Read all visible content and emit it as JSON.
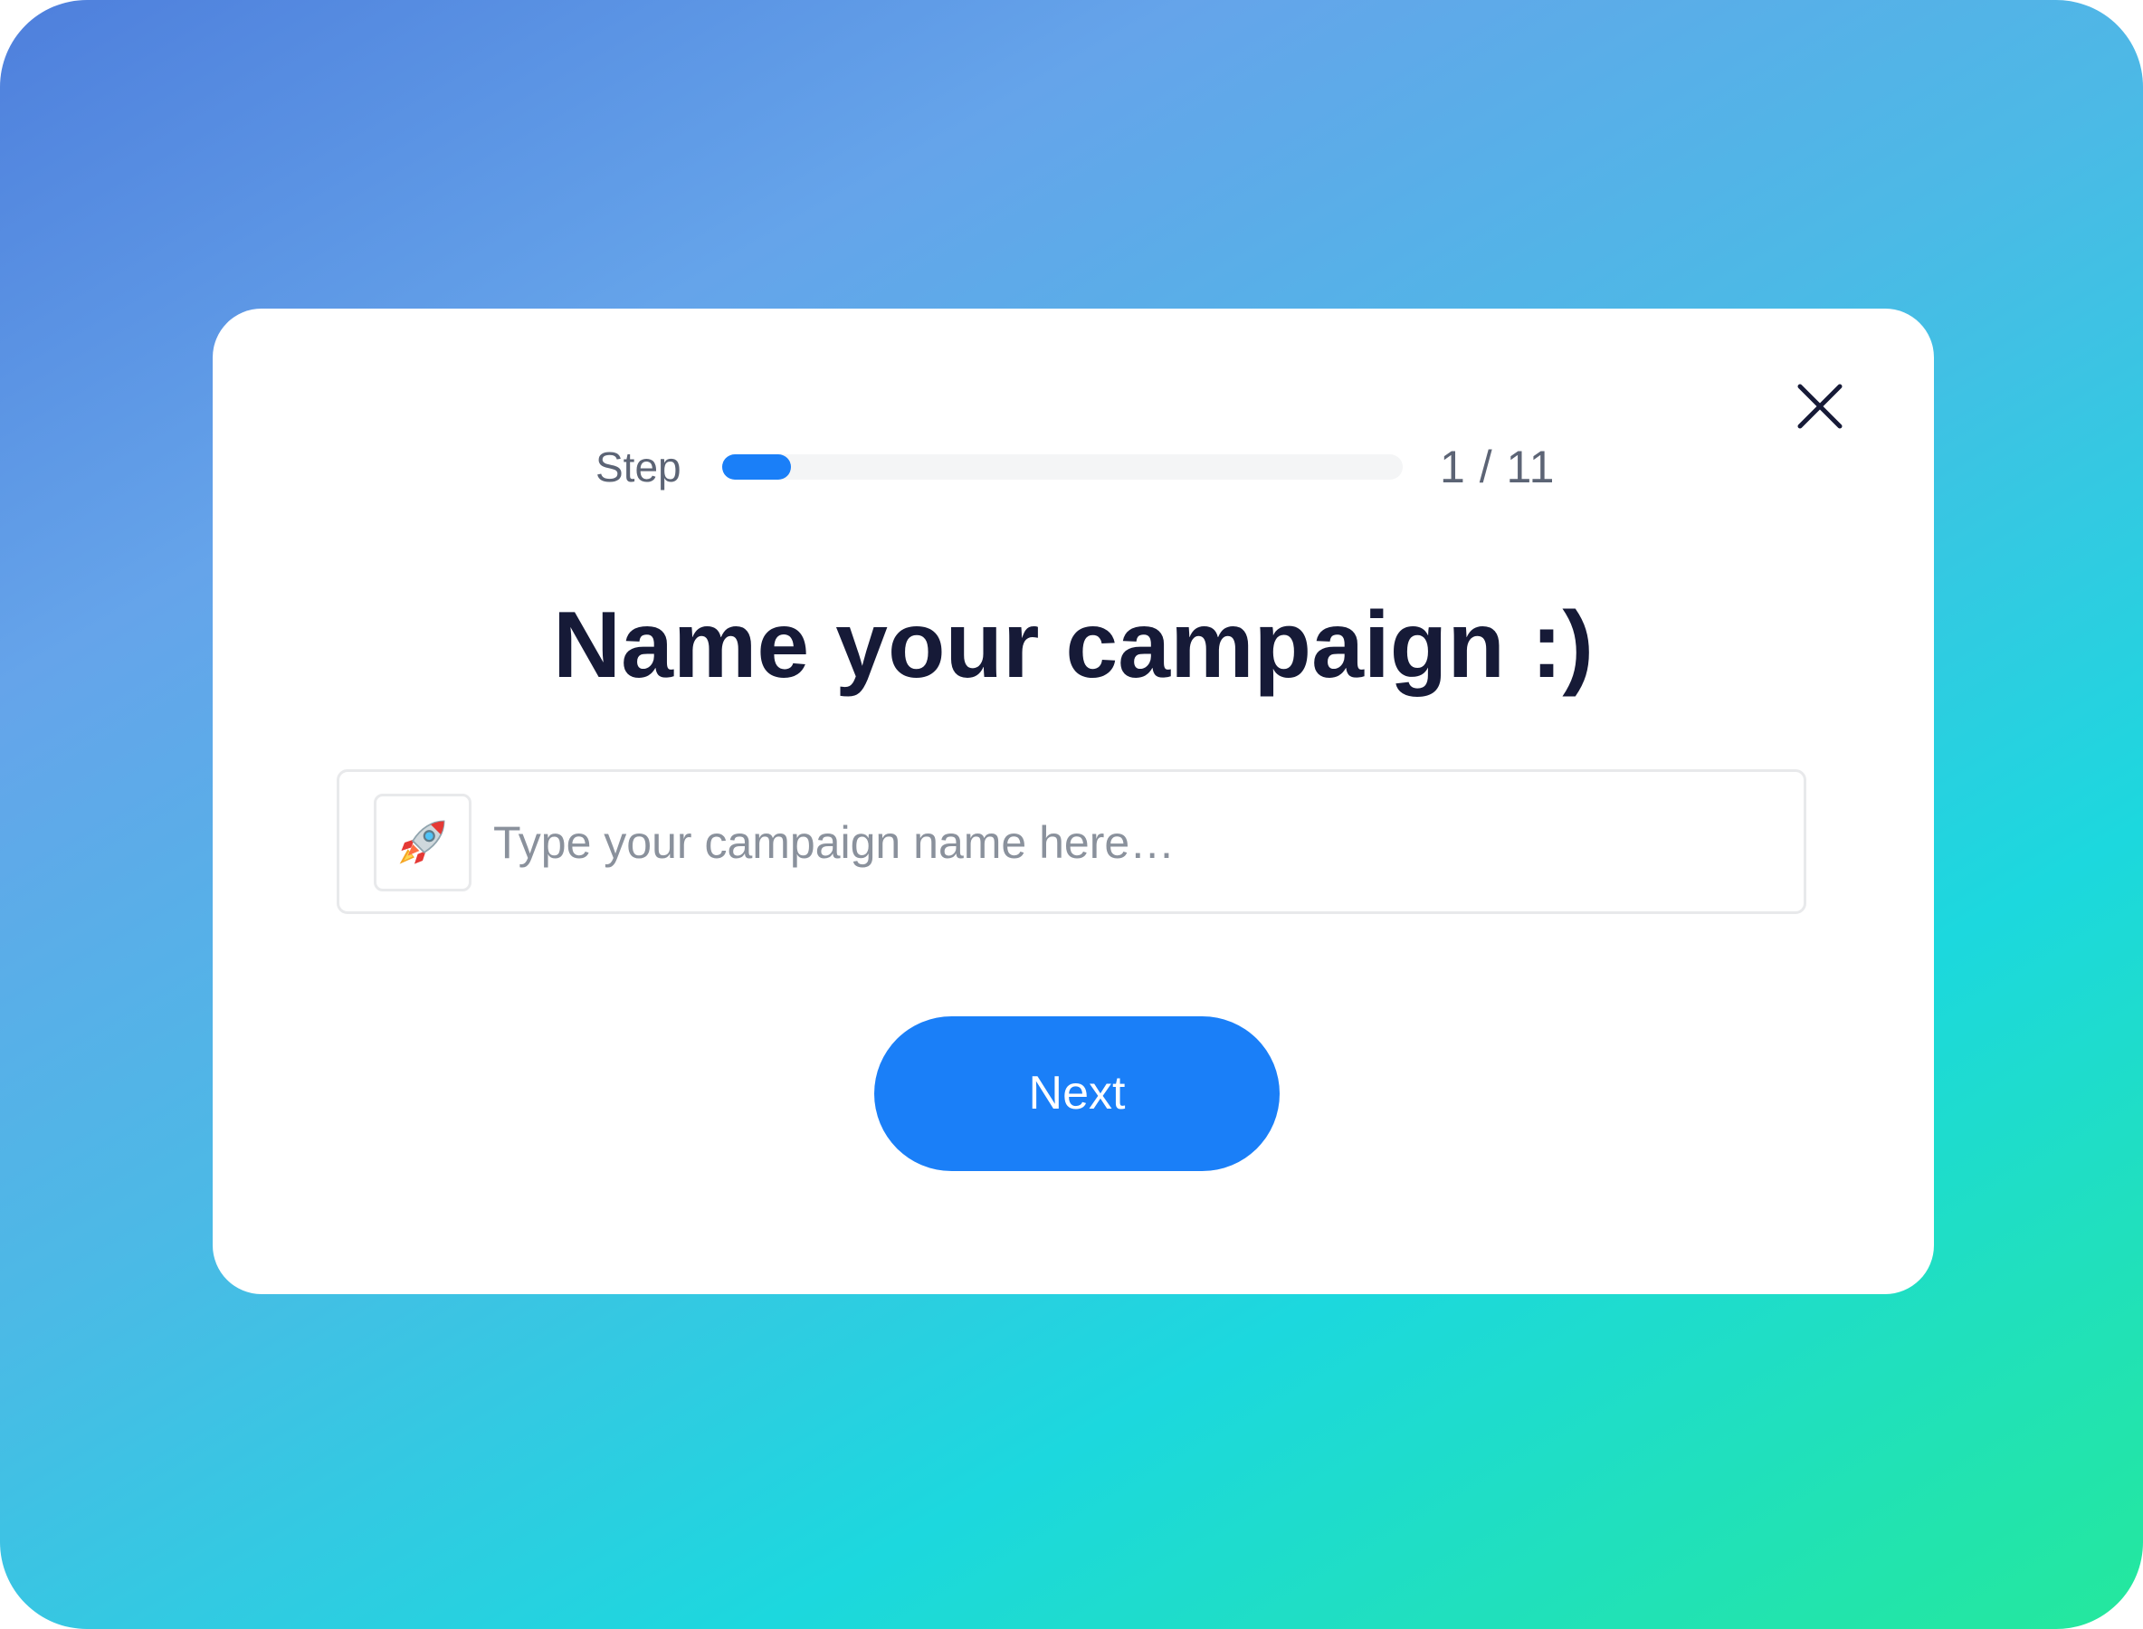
{
  "theme": {
    "accent": "#1a7ff8",
    "title_color": "#161a37",
    "muted_text": "#5c6475",
    "placeholder_color": "#8a919c",
    "border_color": "#e8e9eb",
    "gradient": [
      "#4e7fdc",
      "#65a4ea",
      "#4cb9e6",
      "#1cd8de",
      "#24e89c"
    ]
  },
  "modal": {
    "close_icon": "close-icon",
    "step": {
      "label": "Step",
      "current": 1,
      "total": 11,
      "count_text": "1 / 11",
      "progress_fraction": 0.0909
    },
    "title": "Name your campaign :)",
    "input": {
      "emoji_icon": "rocket-icon",
      "value": "",
      "placeholder": "Type your campaign name here…"
    },
    "next_label": "Next"
  }
}
